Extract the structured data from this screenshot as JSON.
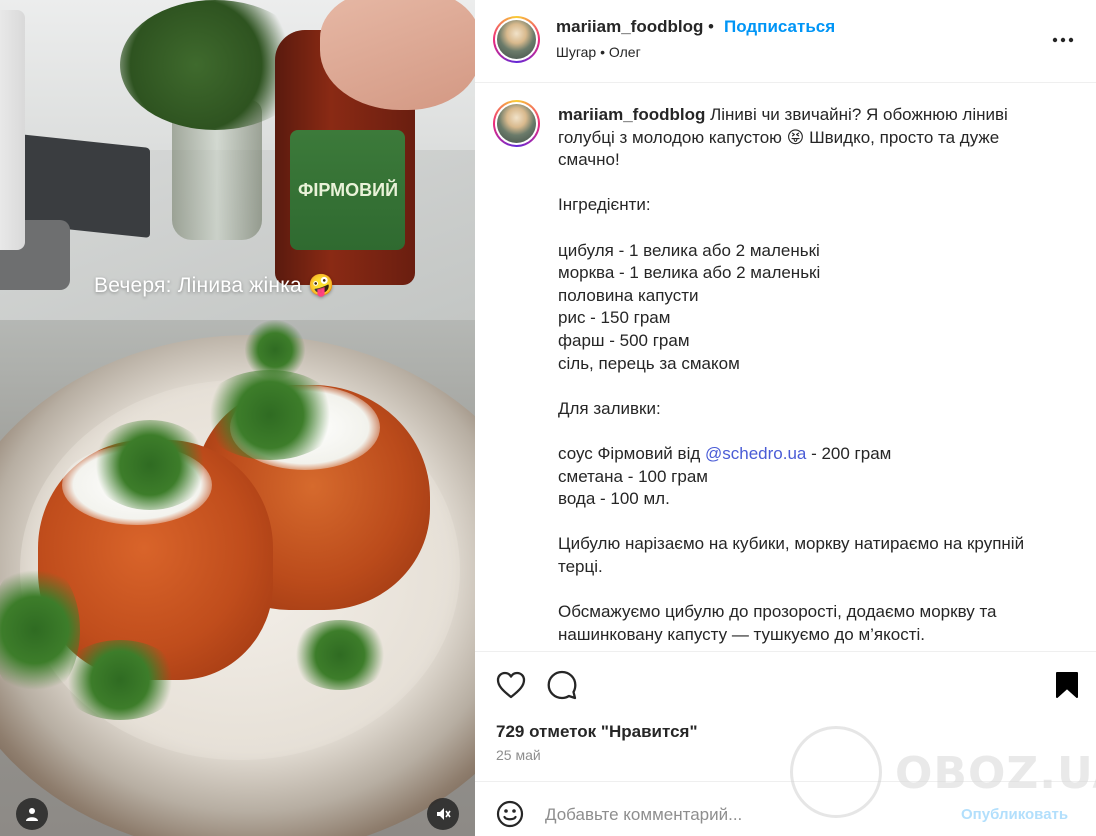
{
  "media": {
    "overlay_caption": "Вечеря: Лінива жінка 🤪",
    "sauce_label": "ФІРМОВИЙ",
    "icons": [
      "user-tag-icon",
      "mute-icon"
    ]
  },
  "header": {
    "username": "mariiam_foodblog",
    "separator": "•",
    "follow_label": "Подписаться",
    "audio": "Шугар • Олег",
    "more_icon": "more-options-icon"
  },
  "caption": {
    "username": "mariiam_foodblog",
    "lines": [
      "Ліниві чи звичайні? Я обожнюю ліниві",
      "голубці з молодою капустою 😝 Швидко, просто та дуже",
      "смачно!",
      "",
      "Інгредієнти:",
      "",
      "цибуля - 1 велика або 2 маленькі",
      "морква - 1 велика або 2 маленькі",
      "половина капусти",
      "рис - 150 грам",
      "фарш - 500 грам",
      "сіль, перець за смаком",
      "",
      "Для заливки:",
      "",
      "соус Фірмовий від ",
      "сметана - 100 грам",
      "вода - 100 мл.",
      "",
      "Цибулю нарізаємо на кубики, моркву натираємо на крупній",
      "терці.",
      "",
      "Обсмажуємо цибулю до прозорості, додаємо моркву та",
      "нашинковану капусту — тушкуємо до м’якості."
    ],
    "sauce_line_prefix": "соус Фірмовий від ",
    "mention": "@schedro.ua",
    "sauce_line_suffix": " - 200 грам"
  },
  "actions": {
    "likes": "729 отметок \"Нравится\"",
    "date": "25 май"
  },
  "comment_box": {
    "placeholder": "Добавьте комментарий...",
    "publish_label": "Опубликовать"
  },
  "watermark": {
    "text": "OBOZ.UA"
  },
  "colors": {
    "accent": "#0095f6",
    "mention": "#4a5cd6",
    "publish_disabled": "#b2dffc",
    "muted_text": "#8e8e8e"
  }
}
